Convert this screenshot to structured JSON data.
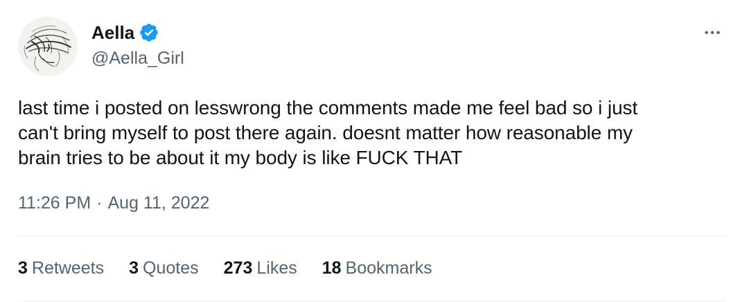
{
  "author": {
    "display_name": "Aella",
    "handle": "@Aella_Girl",
    "verified": true,
    "verified_color": "#1d9bf0"
  },
  "tweet": {
    "text": "last time i posted on lesswrong the comments made me feel bad so i just\ncan't bring myself to post there again. doesnt matter how reasonable my\nbrain tries to be about it my body is like FUCK THAT",
    "time": "11:26 PM",
    "separator": "·",
    "date": "Aug 11, 2022"
  },
  "stats": {
    "retweets_count": "3",
    "retweets_label": "Retweets",
    "quotes_count": "3",
    "quotes_label": "Quotes",
    "likes_count": "273",
    "likes_label": "Likes",
    "bookmarks_count": "18",
    "bookmarks_label": "Bookmarks"
  },
  "icons": {
    "more": "more-horizontal-icon",
    "verified": "verified-badge-icon"
  },
  "colors": {
    "text_primary": "#0f1419",
    "text_secondary": "#536471",
    "divider": "#eff3f4"
  }
}
